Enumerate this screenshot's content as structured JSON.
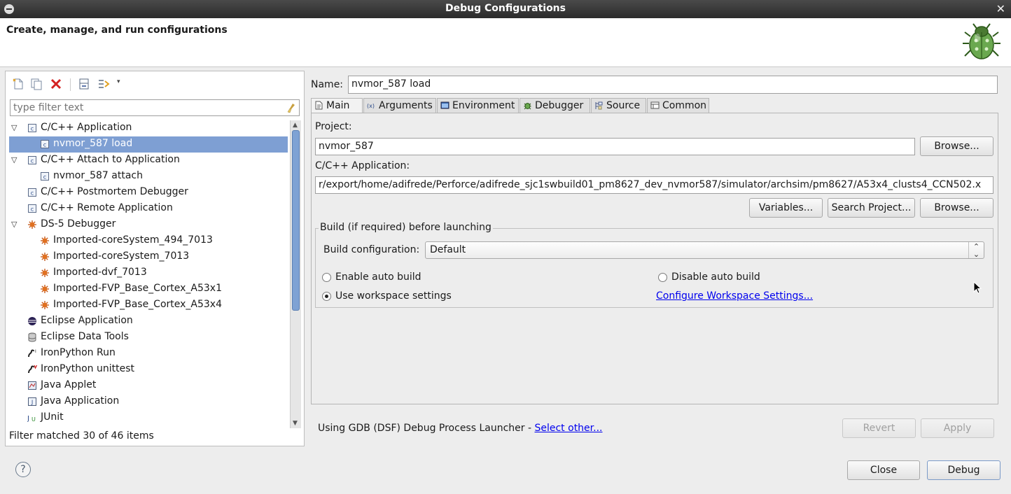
{
  "window": {
    "title": "Debug Configurations",
    "close_glyph": "✕"
  },
  "header": {
    "title": "Create, manage, and run configurations",
    "logo_icon": "debug-bug-icon"
  },
  "left_panel": {
    "toolbar": [
      "new-config-icon",
      "duplicate-config-icon",
      "delete-config-icon",
      "collapse-all-icon",
      "filter-config-icon",
      "view-menu-chevron-icon"
    ],
    "filter_placeholder": "type filter text",
    "tree": [
      {
        "label": "C/C++ Application",
        "level": 0,
        "expanded": true,
        "icon": "c-app-icon"
      },
      {
        "label": "nvmor_587 load",
        "level": 1,
        "selected": true,
        "icon": "c-app-icon"
      },
      {
        "label": "C/C++ Attach to Application",
        "level": 0,
        "expanded": true,
        "icon": "c-app-icon"
      },
      {
        "label": "nvmor_587 attach",
        "level": 1,
        "icon": "c-app-icon"
      },
      {
        "label": "C/C++ Postmortem Debugger",
        "level": 0,
        "icon": "c-app-icon"
      },
      {
        "label": "C/C++ Remote Application",
        "level": 0,
        "icon": "c-app-icon"
      },
      {
        "label": "DS-5 Debugger",
        "level": 0,
        "expanded": true,
        "icon": "ds5-icon"
      },
      {
        "label": "Imported-coreSystem_494_7013",
        "level": 1,
        "icon": "ds5-icon"
      },
      {
        "label": "Imported-coreSystem_7013",
        "level": 1,
        "icon": "ds5-icon"
      },
      {
        "label": "Imported-dvf_7013",
        "level": 1,
        "icon": "ds5-icon"
      },
      {
        "label": "Imported-FVP_Base_Cortex_A53x1",
        "level": 1,
        "icon": "ds5-icon"
      },
      {
        "label": "Imported-FVP_Base_Cortex_A53x4",
        "level": 1,
        "icon": "ds5-icon"
      },
      {
        "label": "Eclipse Application",
        "level": 0,
        "icon": "eclipse-icon"
      },
      {
        "label": "Eclipse Data Tools",
        "level": 0,
        "icon": "database-icon"
      },
      {
        "label": "IronPython Run",
        "level": 0,
        "icon": "python-run-icon"
      },
      {
        "label": "IronPython unittest",
        "level": 0,
        "icon": "python-test-icon"
      },
      {
        "label": "Java Applet",
        "level": 0,
        "icon": "java-applet-icon"
      },
      {
        "label": "Java Application",
        "level": 0,
        "icon": "java-app-icon"
      },
      {
        "label": "JUnit",
        "level": 0,
        "icon": "junit-icon"
      }
    ],
    "status": "Filter matched 30 of 46 items"
  },
  "config": {
    "name_label": "Name:",
    "name_value": "nvmor_587 load",
    "tabs": [
      {
        "label": "Main",
        "icon": "main-tab-icon",
        "active": true
      },
      {
        "label": "Arguments",
        "icon": "arguments-tab-icon"
      },
      {
        "label": "Environment",
        "icon": "environment-tab-icon"
      },
      {
        "label": "Debugger",
        "icon": "debugger-tab-icon"
      },
      {
        "label": "Source",
        "icon": "source-tab-icon"
      },
      {
        "label": "Common",
        "icon": "common-tab-icon"
      }
    ],
    "project_label": "Project:",
    "project_value": "nvmor_587",
    "browse_label": "Browse...",
    "app_label": "C/C++ Application:",
    "app_value": "r/export/home/adifrede/Perforce/adifrede_sjc1swbuild01_pm8627_dev_nvmor587/simulator/archsim/pm8627/A53x4_clusts4_CCN502.x",
    "variables_label": "Variables...",
    "search_project_label": "Search Project...",
    "browse2_label": "Browse...",
    "build_group_title": "Build (if required) before launching",
    "build_config_label": "Build configuration:",
    "build_config_value": "Default",
    "enable_auto_build": "Enable auto build",
    "disable_auto_build": "Disable auto build",
    "use_workspace": "Use workspace settings",
    "configure_workspace_link": "Configure Workspace Settings...",
    "selected_build_option": "use_workspace"
  },
  "launcher": {
    "text": "Using GDB (DSF) Debug Process Launcher - ",
    "link": "Select other...",
    "revert": "Revert",
    "apply": "Apply"
  },
  "footer": {
    "help": "?",
    "close": "Close",
    "debug": "Debug"
  }
}
